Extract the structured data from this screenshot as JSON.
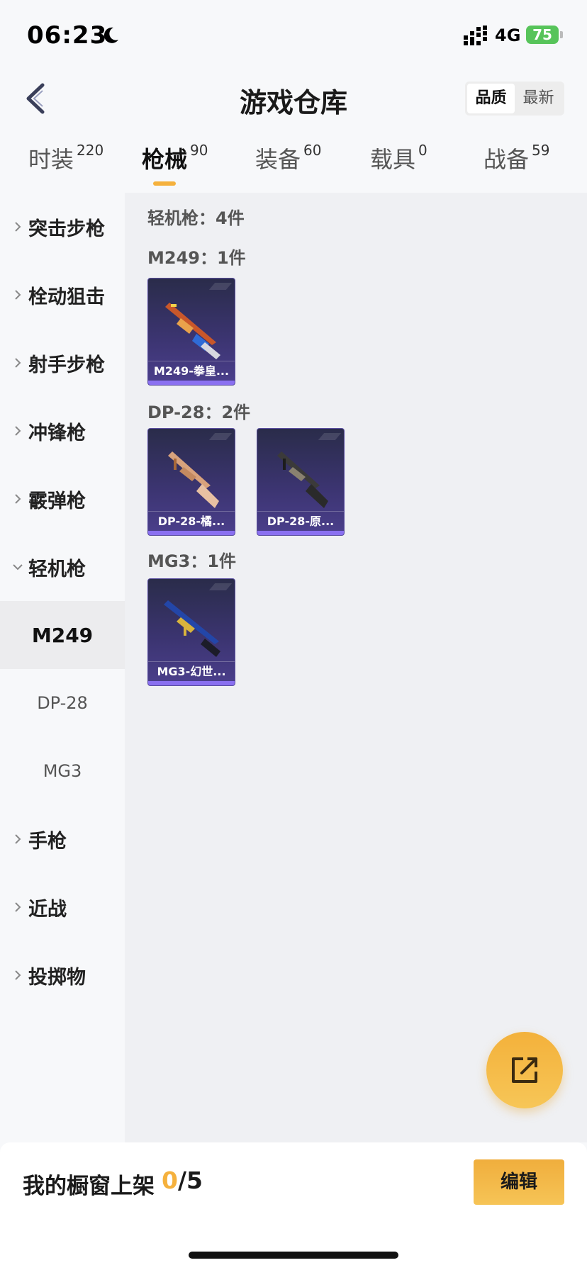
{
  "status_bar": {
    "time": "06:23",
    "network": "4G",
    "battery": "75"
  },
  "header": {
    "title": "游戏仓库",
    "sort_options": [
      "品质",
      "最新"
    ],
    "active_sort": "品质"
  },
  "tabs": [
    {
      "label": "时装",
      "count": "220"
    },
    {
      "label": "枪械",
      "count": "90",
      "active": true
    },
    {
      "label": "装备",
      "count": "60"
    },
    {
      "label": "载具",
      "count": "0"
    },
    {
      "label": "战备",
      "count": "59"
    }
  ],
  "sidebar": {
    "categories": [
      {
        "label": "突击步枪",
        "expanded": false
      },
      {
        "label": "栓动狙击",
        "expanded": false
      },
      {
        "label": "射手步枪",
        "expanded": false
      },
      {
        "label": "冲锋枪",
        "expanded": false
      },
      {
        "label": "霰弹枪",
        "expanded": false
      },
      {
        "label": "轻机枪",
        "expanded": true
      },
      {
        "label": "手枪",
        "expanded": false
      },
      {
        "label": "近战",
        "expanded": false
      },
      {
        "label": "投掷物",
        "expanded": false
      }
    ],
    "subcategories": [
      {
        "label": "M249",
        "active": true
      },
      {
        "label": "DP-28"
      },
      {
        "label": "MG3"
      }
    ]
  },
  "content": {
    "summary": "轻机枪：4件",
    "groups": [
      {
        "label": "M249：1件",
        "items": [
          {
            "name": "M249-拳皇..."
          }
        ]
      },
      {
        "label": "DP-28：2件",
        "items": [
          {
            "name": "DP-28-橘..."
          },
          {
            "name": "DP-28-原..."
          }
        ]
      },
      {
        "label": "MG3：1件",
        "items": [
          {
            "name": "MG3-幻世..."
          }
        ]
      }
    ]
  },
  "bottom": {
    "shelf_label": "我的橱窗上架",
    "used": "0",
    "separator": "/",
    "total": "5",
    "edit_label": "编辑"
  },
  "colors": {
    "accent": "#f5b13d",
    "card_bg": "#3b3470",
    "quality": "#8a70f0"
  }
}
